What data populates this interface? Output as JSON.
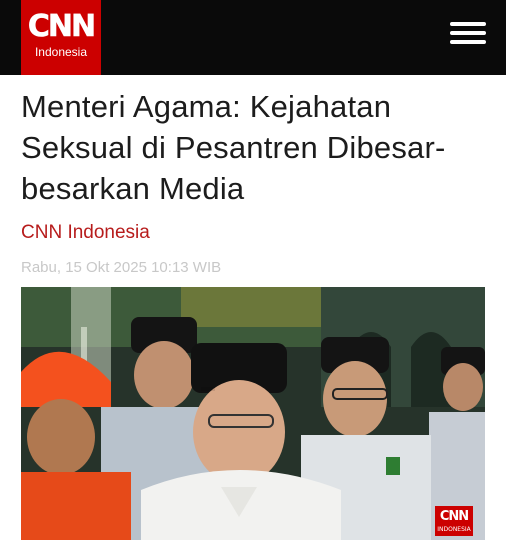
{
  "header": {
    "logo_mark": "CNN",
    "logo_sub": "Indonesia",
    "menu_icon": "hamburger-menu-icon"
  },
  "article": {
    "title": "Menteri Agama: Kejahatan Seksual di Pesantren Dibesar-besarkan Media",
    "source": "CNN Indonesia",
    "date": "Rabu, 15 Okt 2025 10:13 WIB",
    "image": {
      "watermark_mark": "CNN",
      "watermark_sub": "INDONESIA"
    }
  },
  "colors": {
    "brand_red": "#cc0000",
    "topbar": "#0a0a0a",
    "source_text": "#b71c1c",
    "date_text": "#c8c8c8"
  }
}
